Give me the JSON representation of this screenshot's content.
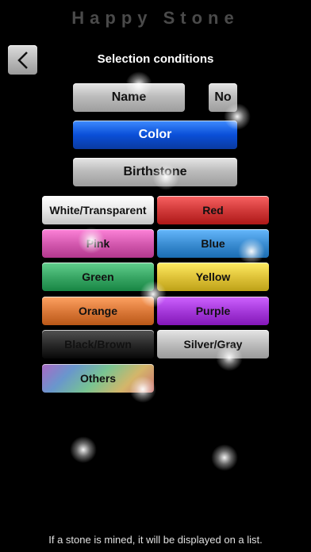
{
  "app": {
    "title": "Happy Stone"
  },
  "header": {
    "back_icon": "chevron-left-icon",
    "subtitle": "Selection conditions"
  },
  "conditions": {
    "name_label": "Name",
    "no_label": "No",
    "color_label": "Color",
    "birthstone_label": "Birthstone",
    "selected": "Color"
  },
  "colors": [
    {
      "label": "White/Transparent",
      "swatch": "#e8e8e8"
    },
    {
      "label": "Red",
      "swatch": "#d13a3a"
    },
    {
      "label": "Pink",
      "swatch": "#d55ab0"
    },
    {
      "label": "Blue",
      "swatch": "#3d8fd4"
    },
    {
      "label": "Green",
      "swatch": "#3aa866"
    },
    {
      "label": "Yellow",
      "swatch": "#e0c43a"
    },
    {
      "label": "Orange",
      "swatch": "#dc7a3a"
    },
    {
      "label": "Purple",
      "swatch": "#a63adb"
    },
    {
      "label": "Black/Brown",
      "swatch": "#2a2a2a"
    },
    {
      "label": "Silver/Gray",
      "swatch": "#bdbdbd"
    },
    {
      "label": "Others",
      "swatch": "multicolor"
    }
  ],
  "footer": {
    "text": "If a stone is mined, it will be displayed on a list."
  }
}
